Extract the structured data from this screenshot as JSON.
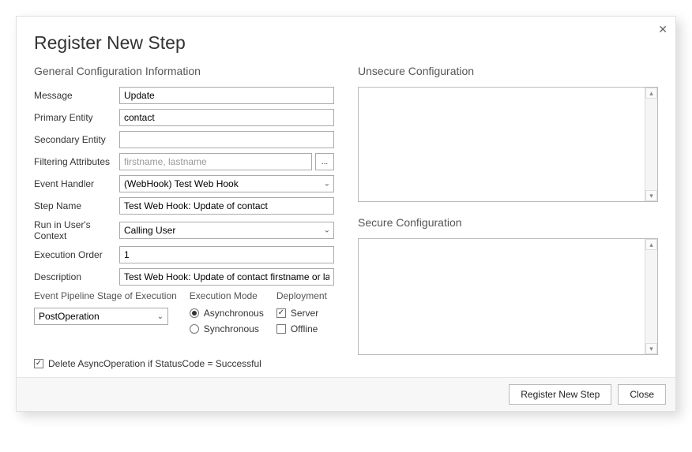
{
  "title": "Register New Step",
  "sections": {
    "general": "General Configuration Information",
    "unsecure": "Unsecure  Configuration",
    "secure": "Secure  Configuration",
    "stage": "Event Pipeline Stage of Execution",
    "execMode": "Execution Mode",
    "deployment": "Deployment"
  },
  "fields": {
    "message": {
      "label": "Message",
      "value": "Update"
    },
    "primaryEntity": {
      "label": "Primary Entity",
      "value": "contact"
    },
    "secondaryEntity": {
      "label": "Secondary Entity",
      "value": ""
    },
    "filteringAttributes": {
      "label": "Filtering Attributes",
      "placeholder": "firstname, lastname",
      "value": ""
    },
    "eventHandler": {
      "label": "Event Handler",
      "value": "(WebHook) Test Web Hook"
    },
    "stepName": {
      "label": "Step Name",
      "value": "Test Web Hook: Update of contact"
    },
    "runInContext": {
      "label": "Run in User's Context",
      "value": "Calling User"
    },
    "executionOrder": {
      "label": "Execution Order",
      "value": "1"
    },
    "description": {
      "label": "Description",
      "value": "Test Web Hook: Update of contact firstname or lastname"
    }
  },
  "stage": "PostOperation",
  "executionMode": {
    "asynchronous": {
      "label": "Asynchronous",
      "checked": true
    },
    "synchronous": {
      "label": "Synchronous",
      "checked": false
    }
  },
  "deployment": {
    "server": {
      "label": "Server",
      "checked": true
    },
    "offline": {
      "label": "Offline",
      "checked": false
    }
  },
  "deleteAsync": {
    "label": "Delete AsyncOperation if StatusCode = Successful",
    "checked": true
  },
  "buttons": {
    "ellipsis": "...",
    "register": "Register New Step",
    "close": "Close"
  }
}
